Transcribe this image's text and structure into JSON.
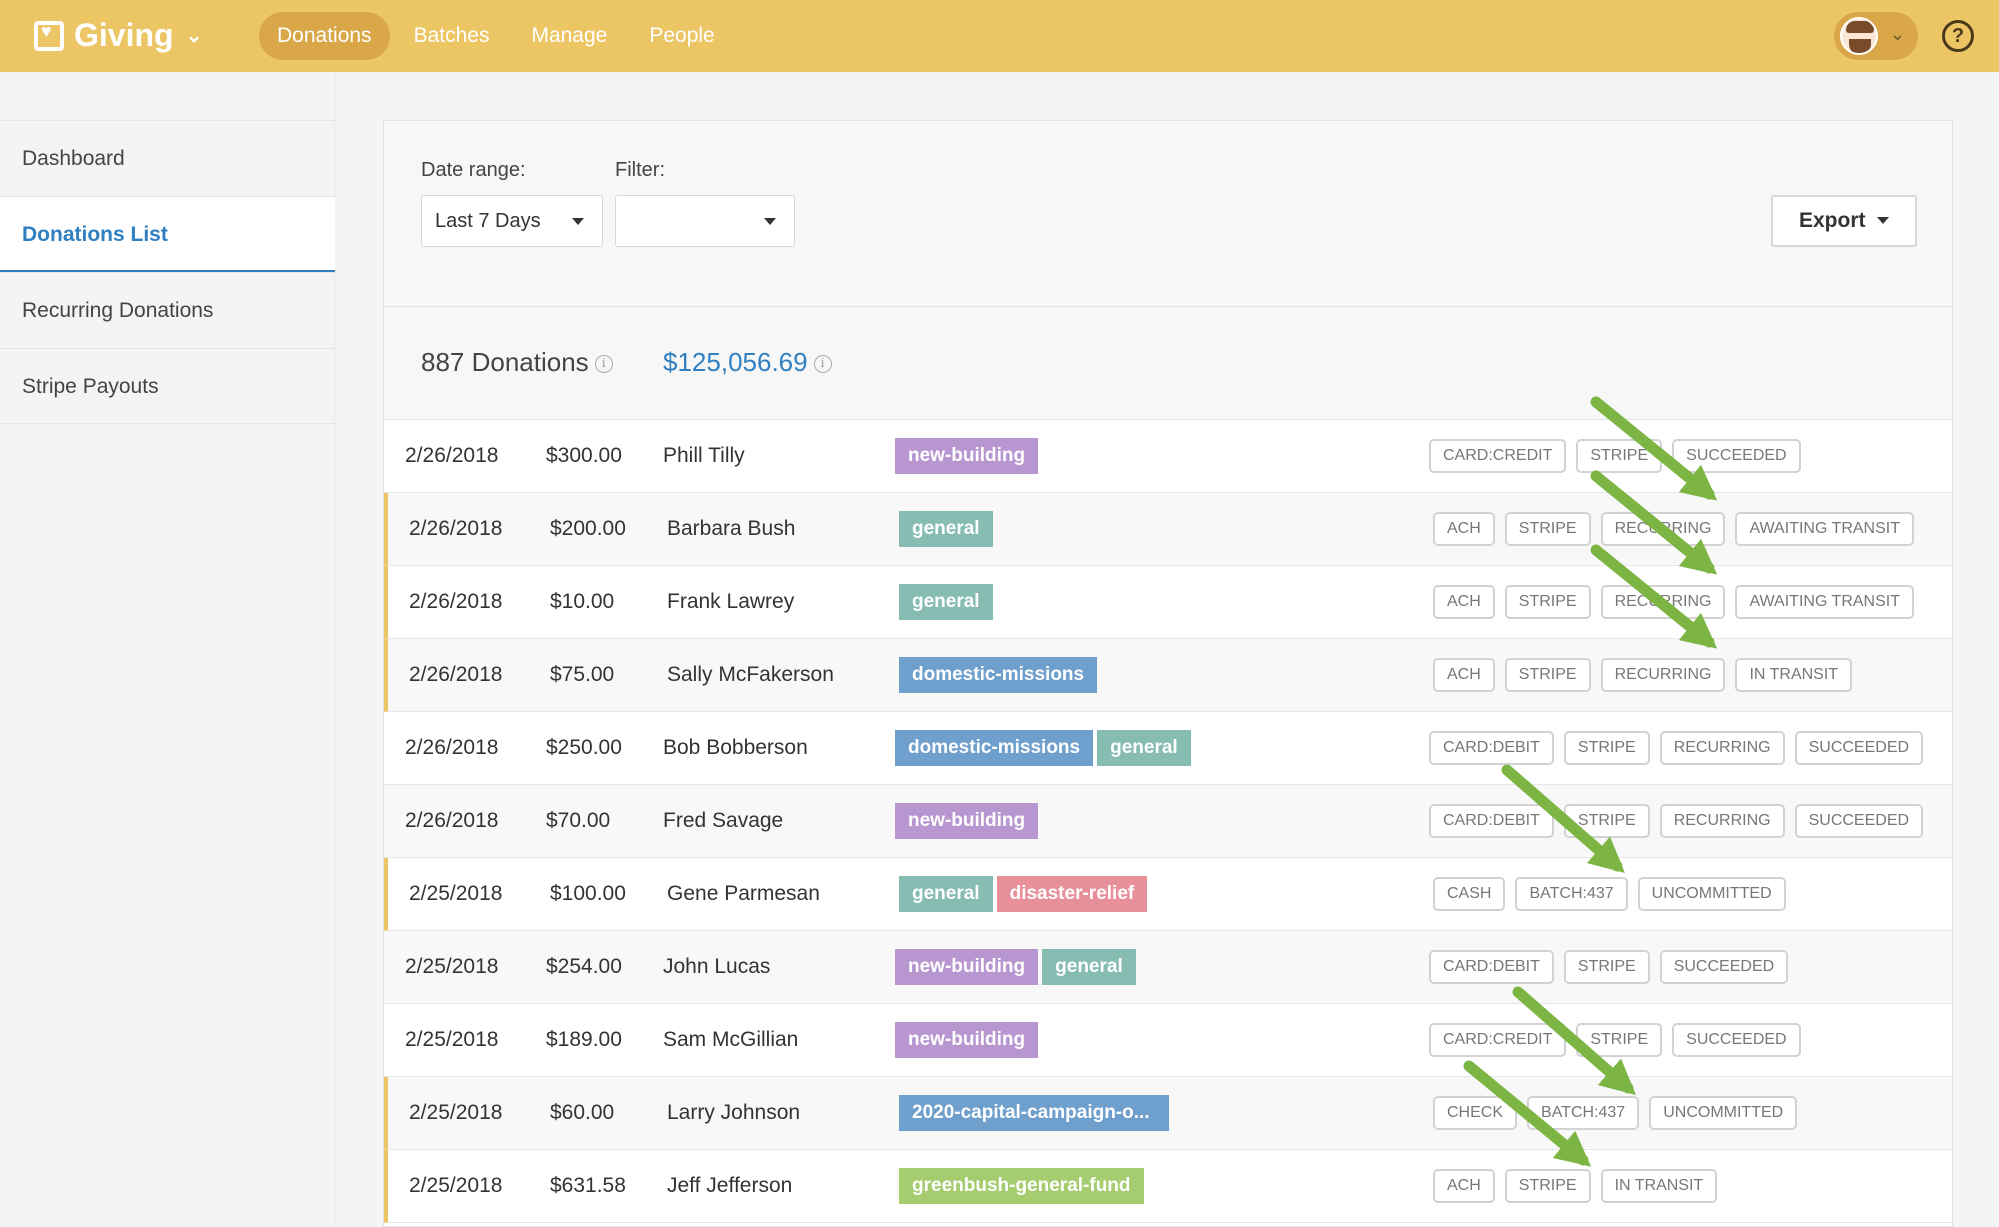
{
  "app": {
    "name": "Giving"
  },
  "nav": [
    {
      "label": "Donations",
      "active": true
    },
    {
      "label": "Batches",
      "active": false
    },
    {
      "label": "Manage",
      "active": false
    },
    {
      "label": "People",
      "active": false
    }
  ],
  "help_label": "?",
  "sidebar": [
    {
      "label": "Dashboard",
      "active": false
    },
    {
      "label": "Donations List",
      "active": true
    },
    {
      "label": "Recurring Donations",
      "active": false
    },
    {
      "label": "Stripe Payouts",
      "active": false
    }
  ],
  "filters": {
    "date_label": "Date range:",
    "date_value": "Last 7 Days",
    "filter_label": "Filter:",
    "filter_value": "",
    "export_label": "Export"
  },
  "summary": {
    "count": "887 Donations",
    "total": "$125,056.69",
    "info_glyph": "i"
  },
  "colors": {
    "topbar": "#ecc665",
    "accent": "#2f7fc1",
    "arrow": "#7db544"
  },
  "donations": [
    {
      "date": "2/26/2018",
      "amount": "$300.00",
      "name": "Phill Tilly",
      "funds": [
        {
          "label": "new-building",
          "color": "purple"
        }
      ],
      "tags": [
        "CARD:CREDIT",
        "STRIPE",
        "SUCCEEDED"
      ],
      "flag": false
    },
    {
      "date": "2/26/2018",
      "amount": "$200.00",
      "name": "Barbara Bush",
      "funds": [
        {
          "label": "general",
          "color": "teal"
        }
      ],
      "tags": [
        "ACH",
        "STRIPE",
        "RECURRING",
        "AWAITING TRANSIT"
      ],
      "flag": true
    },
    {
      "date": "2/26/2018",
      "amount": "$10.00",
      "name": "Frank Lawrey",
      "funds": [
        {
          "label": "general",
          "color": "teal"
        }
      ],
      "tags": [
        "ACH",
        "STRIPE",
        "RECURRING",
        "AWAITING TRANSIT"
      ],
      "flag": true
    },
    {
      "date": "2/26/2018",
      "amount": "$75.00",
      "name": "Sally McFakerson",
      "funds": [
        {
          "label": "domestic-missions",
          "color": "blue"
        }
      ],
      "tags": [
        "ACH",
        "STRIPE",
        "RECURRING",
        "IN TRANSIT"
      ],
      "flag": true
    },
    {
      "date": "2/26/2018",
      "amount": "$250.00",
      "name": "Bob Bobberson",
      "funds": [
        {
          "label": "domestic-missions",
          "color": "blue"
        },
        {
          "label": "general",
          "color": "teal"
        }
      ],
      "tags": [
        "CARD:DEBIT",
        "STRIPE",
        "RECURRING",
        "SUCCEEDED"
      ],
      "flag": false
    },
    {
      "date": "2/26/2018",
      "amount": "$70.00",
      "name": "Fred Savage",
      "funds": [
        {
          "label": "new-building",
          "color": "purple"
        }
      ],
      "tags": [
        "CARD:DEBIT",
        "STRIPE",
        "RECURRING",
        "SUCCEEDED"
      ],
      "flag": false
    },
    {
      "date": "2/25/2018",
      "amount": "$100.00",
      "name": "Gene Parmesan",
      "funds": [
        {
          "label": "general",
          "color": "teal"
        },
        {
          "label": "disaster-relief",
          "color": "pink"
        }
      ],
      "tags": [
        "CASH",
        "BATCH:437",
        "UNCOMMITTED"
      ],
      "flag": true
    },
    {
      "date": "2/25/2018",
      "amount": "$254.00",
      "name": "John Lucas",
      "funds": [
        {
          "label": "new-building",
          "color": "purple"
        },
        {
          "label": "general",
          "color": "teal"
        }
      ],
      "tags": [
        "CARD:DEBIT",
        "STRIPE",
        "SUCCEEDED"
      ],
      "flag": false
    },
    {
      "date": "2/25/2018",
      "amount": "$189.00",
      "name": "Sam McGillian",
      "funds": [
        {
          "label": "new-building",
          "color": "purple"
        }
      ],
      "tags": [
        "CARD:CREDIT",
        "STRIPE",
        "SUCCEEDED"
      ],
      "flag": false
    },
    {
      "date": "2/25/2018",
      "amount": "$60.00",
      "name": "Larry Johnson",
      "funds": [
        {
          "label": "2020-capital-campaign-o...",
          "color": "blue",
          "truncated": true
        }
      ],
      "tags": [
        "CHECK",
        "BATCH:437",
        "UNCOMMITTED"
      ],
      "flag": true
    },
    {
      "date": "2/25/2018",
      "amount": "$631.58",
      "name": "Jeff Jefferson",
      "funds": [
        {
          "label": "greenbush-general-fund",
          "color": "green"
        }
      ],
      "tags": [
        "ACH",
        "STRIPE",
        "IN TRANSIT"
      ],
      "flag": true
    }
  ]
}
